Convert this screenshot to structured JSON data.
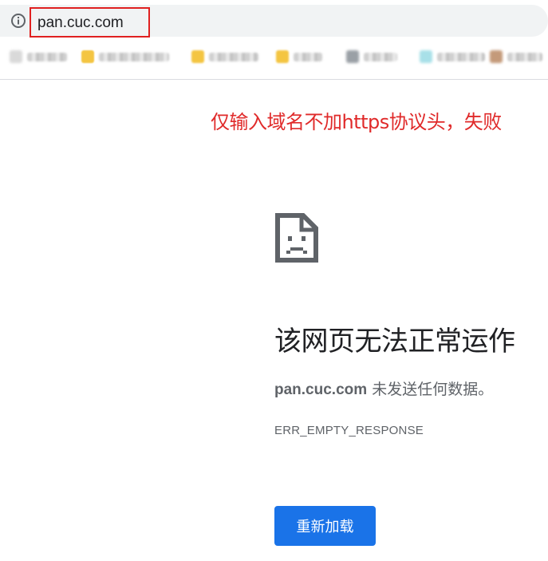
{
  "omnibox": {
    "url": "pan.cuc.com",
    "info_icon": "info-circle-icon"
  },
  "bookmarks_bar": {
    "items": [
      {
        "icon": "blurred-favicon",
        "icon_color": "#d9d9d9"
      },
      {
        "icon": "folder-icon",
        "icon_color": "#f4c542",
        "partial_label": "ping"
      },
      {
        "icon": "folder-icon",
        "icon_color": "#f4c542"
      },
      {
        "icon": "folder-icon",
        "icon_color": "#f4c542",
        "partial_label": "ic"
      },
      {
        "icon": "blurred-favicon",
        "icon_color": "#9aa0a6"
      },
      {
        "icon": "blurred-favicon",
        "icon_color": "#a8e0e8"
      },
      {
        "icon": "blurred-favicon",
        "icon_color": "#c49a7a"
      }
    ]
  },
  "annotation": {
    "text": "仅输入域名不加https协议头，失败",
    "color": "#e02a2a"
  },
  "error_page": {
    "icon": "sad-page-icon",
    "title": "该网页无法正常运作",
    "host": "pan.cuc.com",
    "description_suffix": " 未发送任何数据。",
    "error_code": "ERR_EMPTY_RESPONSE",
    "reload_label": "重新加载",
    "button_color": "#1a73e8"
  }
}
